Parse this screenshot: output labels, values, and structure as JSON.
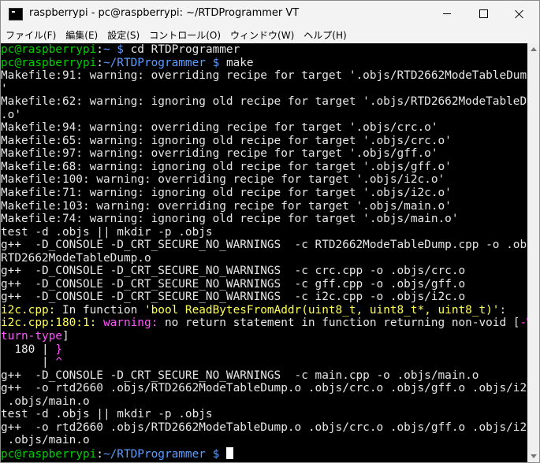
{
  "window": {
    "title": "raspberrypi - pc@raspberrypi: ~/RTDProgrammer VT"
  },
  "menu": [
    "ファイル(F)",
    "編集(E)",
    "設定(S)",
    "コントロール(O)",
    "ウィンドウ(W)",
    "ヘルプ(H)"
  ],
  "terminal": {
    "prompt1": {
      "userhost": "pc@raspberrypi",
      "path": "~",
      "command": "cd RTDProgrammer"
    },
    "prompt2": {
      "userhost": "pc@raspberrypi",
      "path": "~/RTDProgrammer",
      "command": "make"
    },
    "output": [
      "Makefile:91: warning: overriding recipe for target '.objs/RTD2662ModeTableDump.o",
      "'",
      "Makefile:62: warning: ignoring old recipe for target '.objs/RTD2662ModeTableDump",
      ".o'",
      "Makefile:94: warning: overriding recipe for target '.objs/crc.o'",
      "Makefile:65: warning: ignoring old recipe for target '.objs/crc.o'",
      "Makefile:97: warning: overriding recipe for target '.objs/gff.o'",
      "Makefile:68: warning: ignoring old recipe for target '.objs/gff.o'",
      "Makefile:100: warning: overriding recipe for target '.objs/i2c.o'",
      "Makefile:71: warning: ignoring old recipe for target '.objs/i2c.o'",
      "Makefile:103: warning: overriding recipe for target '.objs/main.o'",
      "Makefile:74: warning: ignoring old recipe for target '.objs/main.o'",
      "test -d .objs || mkdir -p .objs",
      "g++  -D_CONSOLE -D_CRT_SECURE_NO_WARNINGS  -c RTD2662ModeTableDump.cpp -o .objs/",
      "RTD2662ModeTableDump.o",
      "g++  -D_CONSOLE -D_CRT_SECURE_NO_WARNINGS  -c crc.cpp -o .objs/crc.o",
      "g++  -D_CONSOLE -D_CRT_SECURE_NO_WARNINGS  -c gff.cpp -o .objs/gff.o",
      "g++  -D_CONSOLE -D_CRT_SECURE_NO_WARNINGS  -c i2c.cpp -o .objs/i2c.o"
    ],
    "diag_func": {
      "file": "i2c.cpp:",
      "text": " In function ",
      "func": "'bool ReadBytesFromAddr(uint8_t, uint8_t*, uint8_t)'",
      "end": ":"
    },
    "diag_warn": {
      "loc": "i2c.cpp:180:1:",
      "label": " warning:",
      "text": " no return statement in function returning non-void [",
      "flag1": "-Wre",
      "flag2": "turn-type",
      "close": "]"
    },
    "source_line": {
      "num": "  180 | ",
      "brace": "}"
    },
    "source_caret": {
      "pad": "      | ",
      "caret": "^"
    },
    "output2": [
      "g++  -D_CONSOLE -D_CRT_SECURE_NO_WARNINGS  -c main.cpp -o .objs/main.o",
      "g++  -o rtd2660 .objs/RTD2662ModeTableDump.o .objs/crc.o .objs/gff.o .objs/i2c.o",
      " .objs/main.o",
      "test -d .objs || mkdir -p .objs",
      "g++  -o rtd2660 .objs/RTD2662ModeTableDump.o .objs/crc.o .objs/gff.o .objs/i2c.o",
      " .objs/main.o"
    ],
    "prompt3": {
      "userhost": "pc@raspberrypi",
      "path": "~/RTDProgrammer",
      "command": ""
    }
  }
}
